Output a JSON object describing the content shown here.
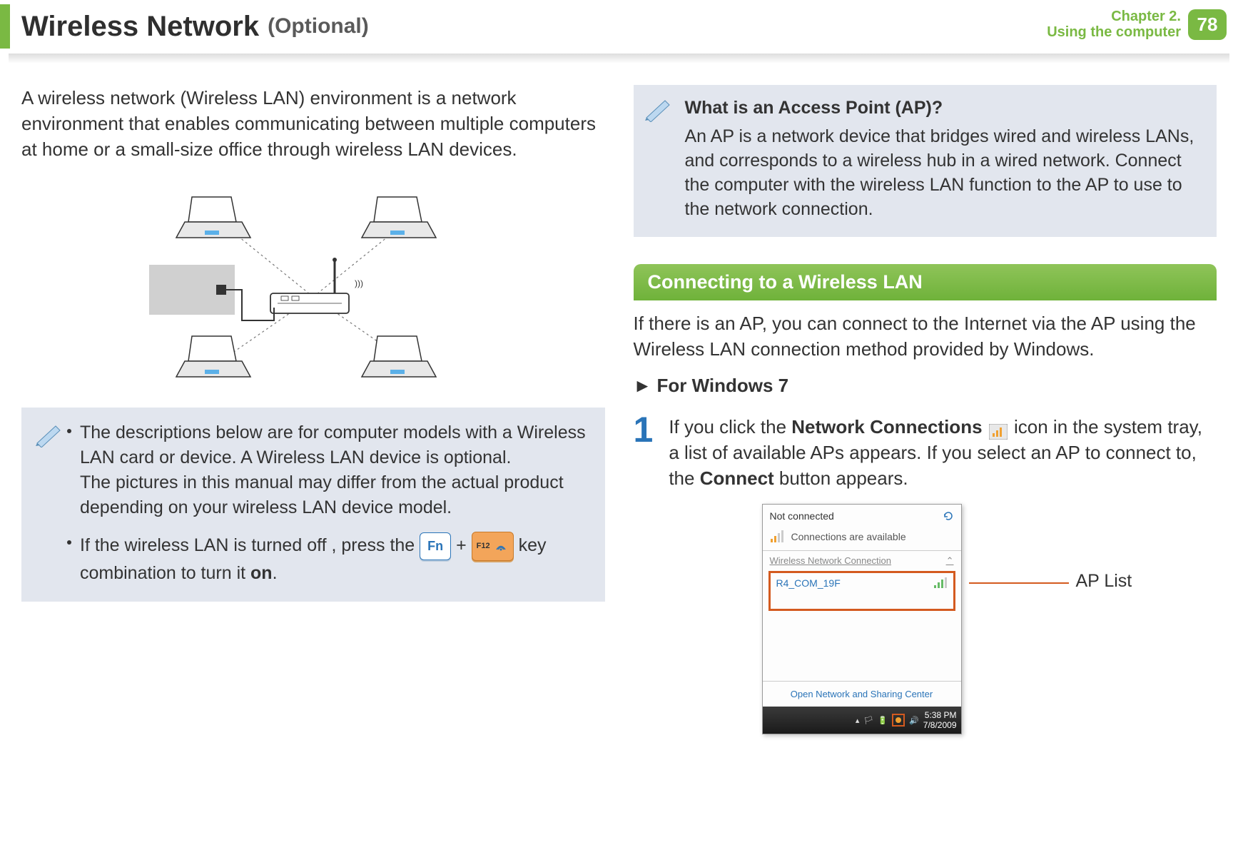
{
  "header": {
    "title": "Wireless Network",
    "subtitle": "(Optional)",
    "chapter_line1": "Chapter 2.",
    "chapter_line2": "Using the computer",
    "page_number": "78"
  },
  "left": {
    "intro": "A wireless network (Wireless LAN) environment is a network environment that enables communicating between multiple computers at home or a small-size office through wireless LAN devices.",
    "note1_a": "The descriptions below are for computer models with a Wireless LAN card or device. A Wireless LAN device is optional.",
    "note1_b": "The pictures in this manual may differ from the actual product depending on your wireless LAN device model.",
    "note2_a": "If the wireless LAN is turned off , press the ",
    "note2_plus": " + ",
    "note2_b": " key combination to turn it ",
    "note2_on": "on",
    "note2_period": ".",
    "key_fn": "Fn",
    "key_f12": "F12"
  },
  "right": {
    "ap_q": "What is an Access Point (AP)?",
    "ap_body": "An AP is a network device that bridges wired and wireless LANs, and corresponds to a wireless hub in a wired network. Connect the computer with the wireless LAN function to the AP to use to the network connection.",
    "section_heading": "Connecting to a Wireless LAN",
    "section_intro": "If there is an AP, you can connect to the Internet via the AP using the Wireless LAN connection method provided by Windows.",
    "subheading_marker": "►",
    "subheading": "For Windows 7",
    "step1_num": "1",
    "step1_a": "If you click the ",
    "step1_nc": "Network Connections",
    "step1_b": " icon in the system tray, a list of available APs appears. If you select an AP to connect to, the ",
    "step1_connect": "Connect",
    "step1_c": " button appears.",
    "callout": "AP List"
  },
  "screenshot": {
    "not_connected": "Not connected",
    "conn_avail": "Connections are available",
    "section_title": "Wireless Network Connection",
    "ap_name": "R4_COM_19F",
    "open_center": "Open Network and Sharing Center",
    "time": "5:38 PM",
    "date": "7/8/2009"
  }
}
